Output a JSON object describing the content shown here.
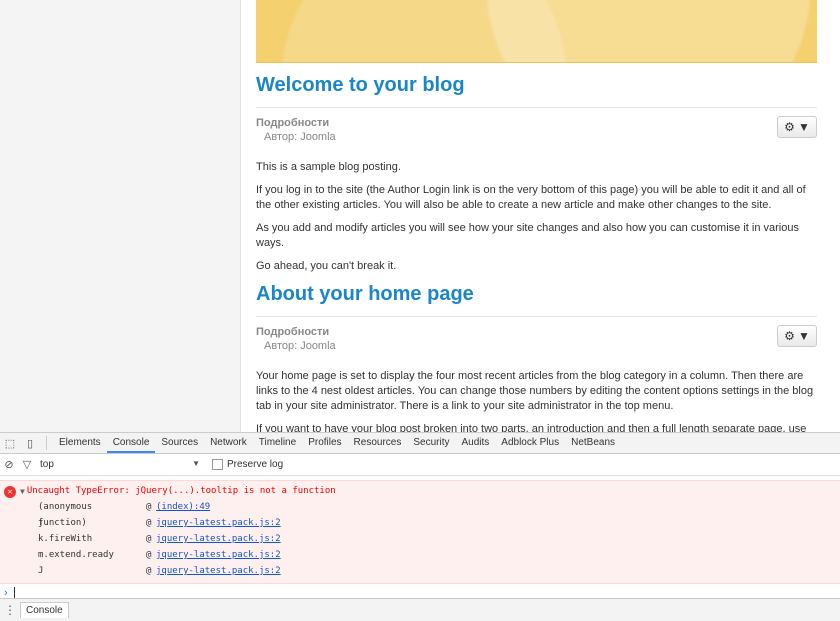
{
  "articles": [
    {
      "title": "Welcome to your blog",
      "details_label": "Подробности",
      "author": "Автор: Joomla",
      "paragraphs": [
        "This is a sample blog posting.",
        "If you log in to the site (the Author Login link is on the very bottom of this page) you will be able to edit it and all of the other existing articles. You will also be able to create a new article and make other changes to the site.",
        "As you add and modify articles you will see how your site changes and also how you can customise it in various ways.",
        "Go ahead, you can't break it."
      ]
    },
    {
      "title": "About your home page",
      "details_label": "Подробности",
      "author": "Автор: Joomla",
      "paragraphs": [
        "Your home page is set to display the four most recent articles from the blog category in a column. Then there are links to the 4 nest oldest articles. You can change those numbers by editing the content options settings in the blog tab in your site administrator. There is a link to your site administrator in the top menu.",
        "If you want to have your blog post broken into two parts, an introduction and then a full length separate page, use the Read More button to insert a break."
      ]
    }
  ],
  "devtools": {
    "tabs": [
      "Elements",
      "Console",
      "Sources",
      "Network",
      "Timeline",
      "Profiles",
      "Resources",
      "Security",
      "Audits",
      "Adblock Plus",
      "NetBeans"
    ],
    "active_tab": "Console",
    "context": "top",
    "preserve_log_label": "Preserve log",
    "error": {
      "message": "Uncaught TypeError: jQuery(...).tooltip is not a function",
      "stack": [
        {
          "fn": "(anonymous function)",
          "src": "(index):49"
        },
        {
          "fn": "j",
          "src": "jquery-latest.pack.js:2"
        },
        {
          "fn": "k.fireWith",
          "src": "jquery-latest.pack.js:2"
        },
        {
          "fn": "m.extend.ready",
          "src": "jquery-latest.pack.js:2"
        },
        {
          "fn": "J",
          "src": "jquery-latest.pack.js:2"
        }
      ]
    },
    "prompt_symbol": "›",
    "drawer_tab": "Console"
  },
  "icons": {
    "gear": "gear-icon",
    "inspect": "inspect-icon",
    "device": "device-icon",
    "clear": "clear-icon",
    "filter": "filter-icon",
    "error": "error-icon",
    "menu": "menu-dots-icon"
  },
  "colors": {
    "title_blue": "#1a86c8",
    "banner_yellow": "#f4d06f",
    "error_red": "#e00000",
    "error_bg": "#fff0f0"
  }
}
